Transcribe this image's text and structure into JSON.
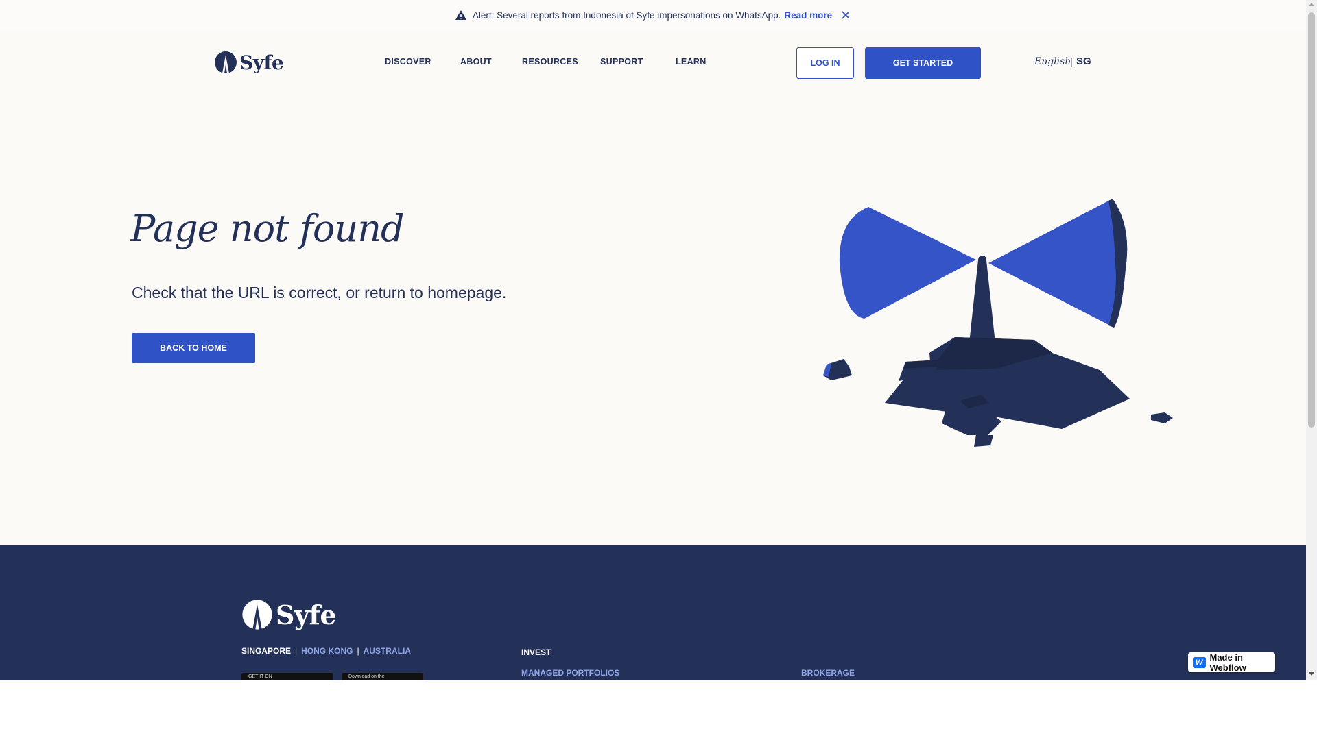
{
  "alert": {
    "icon": "warning-icon",
    "text": "Alert: Several reports from Indonesia of Syfe impersonations on WhatsApp.",
    "link_label": "Read more",
    "close_icon": "close-icon"
  },
  "header": {
    "logo_text": "Syfe",
    "nav": [
      "DISCOVER",
      "ABOUT",
      "RESOURCES",
      "SUPPORT",
      "LEARN"
    ],
    "login_label": "LOG IN",
    "cta_label": "GET STARTED",
    "language": "English",
    "separator": "|",
    "region": "SG"
  },
  "hero": {
    "title": "Page not found",
    "subtitle": "Check that the URL is correct, or return to homepage.",
    "button_label": "BACK TO HOME"
  },
  "footer": {
    "logo_text": "Syfe",
    "regions": {
      "active": "SINGAPORE",
      "others": [
        "HONG KONG",
        "AUSTRALIA"
      ],
      "separator": "|"
    },
    "stores": [
      "GET IT ON",
      "Download on the"
    ],
    "columns": {
      "invest_heading": "INVEST",
      "invest_link": "MANAGED PORTFOLIOS",
      "brokerage_link": "BROKERAGE"
    }
  },
  "badge": {
    "label": "Made in Webflow",
    "logo": "W"
  },
  "colors": {
    "navy": "#233057",
    "brand_blue": "#2f52c7",
    "link_blue": "#8fa4e8",
    "background": "#fcfaf7"
  }
}
